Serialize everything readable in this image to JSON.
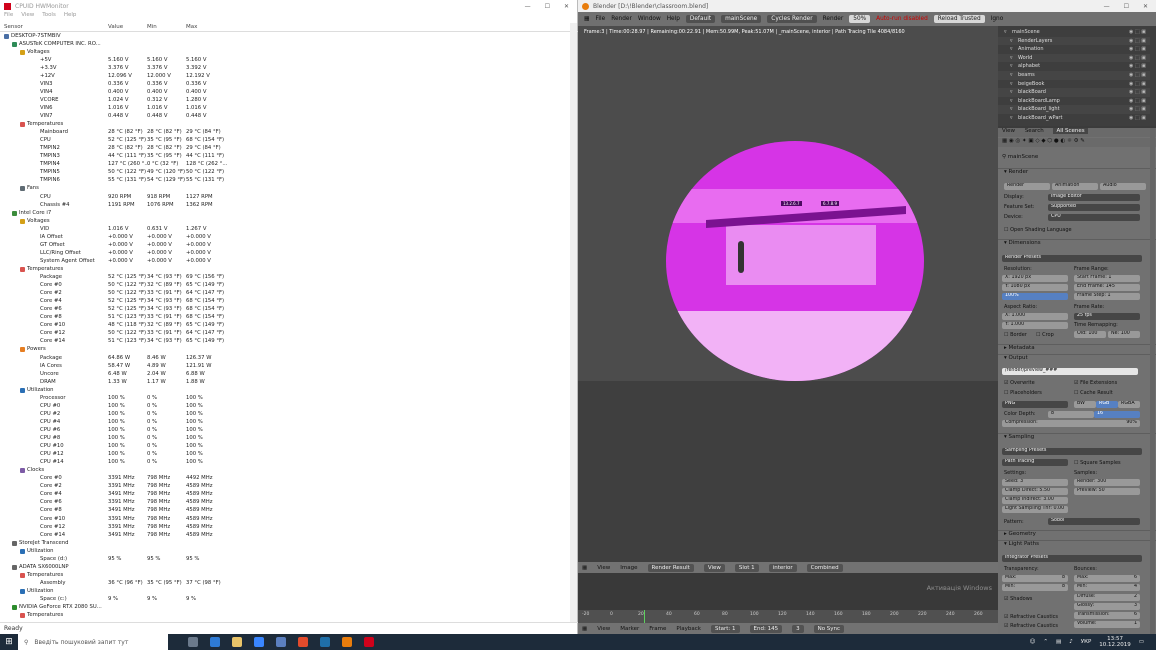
{
  "hwmonitor": {
    "title": "CPUID HWMonitor",
    "menu": [
      "File",
      "View",
      "Tools",
      "Help"
    ],
    "columns": [
      "Sensor",
      "Value",
      "Min",
      "Max"
    ],
    "status": "Ready",
    "rows": [
      {
        "indent": 0,
        "icon": "computer-icon",
        "sensor": "DESKTOP-7STMBIV",
        "value": "",
        "min": "",
        "max": ""
      },
      {
        "indent": 1,
        "icon": "motherboard-icon",
        "sensor": "ASUSTeK COMPUTER INC. RO...",
        "value": "",
        "min": "",
        "max": ""
      },
      {
        "indent": 2,
        "icon": "voltage-icon",
        "sensor": "Voltages",
        "value": "",
        "min": "",
        "max": ""
      },
      {
        "indent": 3,
        "icon": "",
        "sensor": "+5V",
        "value": "5.160 V",
        "min": "5.160 V",
        "max": "5.160 V"
      },
      {
        "indent": 3,
        "icon": "",
        "sensor": "+3.3V",
        "value": "3.376 V",
        "min": "3.376 V",
        "max": "3.392 V"
      },
      {
        "indent": 3,
        "icon": "",
        "sensor": "+12V",
        "value": "12.096 V",
        "min": "12.000 V",
        "max": "12.192 V"
      },
      {
        "indent": 3,
        "icon": "",
        "sensor": "VIN3",
        "value": "0.336 V",
        "min": "0.336 V",
        "max": "0.336 V"
      },
      {
        "indent": 3,
        "icon": "",
        "sensor": "VIN4",
        "value": "0.400 V",
        "min": "0.400 V",
        "max": "0.400 V"
      },
      {
        "indent": 3,
        "icon": "",
        "sensor": "VCORE",
        "value": "1.024 V",
        "min": "0.312 V",
        "max": "1.280 V"
      },
      {
        "indent": 3,
        "icon": "",
        "sensor": "VIN6",
        "value": "1.016 V",
        "min": "1.016 V",
        "max": "1.016 V"
      },
      {
        "indent": 3,
        "icon": "",
        "sensor": "VIN7",
        "value": "0.448 V",
        "min": "0.448 V",
        "max": "0.448 V"
      },
      {
        "indent": 2,
        "icon": "temperature-icon",
        "sensor": "Temperatures",
        "value": "",
        "min": "",
        "max": ""
      },
      {
        "indent": 3,
        "icon": "",
        "sensor": "Mainboard",
        "value": "28 °C (82 °F)",
        "min": "28 °C (82 °F)",
        "max": "29 °C (84 °F)"
      },
      {
        "indent": 3,
        "icon": "",
        "sensor": "CPU",
        "value": "52 °C (125 °F)",
        "min": "35 °C (95 °F)",
        "max": "68 °C (154 °F)"
      },
      {
        "indent": 3,
        "icon": "",
        "sensor": "TMPIN2",
        "value": "28 °C (82 °F)",
        "min": "28 °C (82 °F)",
        "max": "29 °C (84 °F)"
      },
      {
        "indent": 3,
        "icon": "",
        "sensor": "TMPIN3",
        "value": "44 °C (111 °F)",
        "min": "35 °C (95 °F)",
        "max": "44 °C (111 °F)"
      },
      {
        "indent": 3,
        "icon": "",
        "sensor": "TMPIN4",
        "value": "127 °C (260 °...",
        "min": "0 °C (32 °F)",
        "max": "128 °C (262 °..."
      },
      {
        "indent": 3,
        "icon": "",
        "sensor": "TMPIN5",
        "value": "50 °C (122 °F)",
        "min": "49 °C (120 °F)",
        "max": "50 °C (122 °F)"
      },
      {
        "indent": 3,
        "icon": "",
        "sensor": "TMPIN6",
        "value": "55 °C (131 °F)",
        "min": "54 °C (129 °F)",
        "max": "55 °C (131 °F)"
      },
      {
        "indent": 2,
        "icon": "fan-icon",
        "sensor": "Fans",
        "value": "",
        "min": "",
        "max": ""
      },
      {
        "indent": 3,
        "icon": "",
        "sensor": "CPU",
        "value": "920 RPM",
        "min": "918 RPM",
        "max": "1127 RPM"
      },
      {
        "indent": 3,
        "icon": "",
        "sensor": "Chassis #4",
        "value": "1191 RPM",
        "min": "1076 RPM",
        "max": "1362 RPM"
      },
      {
        "indent": 1,
        "icon": "cpu-icon",
        "sensor": "Intel Core i7",
        "value": "",
        "min": "",
        "max": ""
      },
      {
        "indent": 2,
        "icon": "voltage-icon",
        "sensor": "Voltages",
        "value": "",
        "min": "",
        "max": ""
      },
      {
        "indent": 3,
        "icon": "",
        "sensor": "VID",
        "value": "1.016 V",
        "min": "0.631 V",
        "max": "1.267 V"
      },
      {
        "indent": 3,
        "icon": "",
        "sensor": "IA Offset",
        "value": "+0.000 V",
        "min": "+0.000 V",
        "max": "+0.000 V"
      },
      {
        "indent": 3,
        "icon": "",
        "sensor": "GT Offset",
        "value": "+0.000 V",
        "min": "+0.000 V",
        "max": "+0.000 V"
      },
      {
        "indent": 3,
        "icon": "",
        "sensor": "LLC/Ring Offset",
        "value": "+0.000 V",
        "min": "+0.000 V",
        "max": "+0.000 V"
      },
      {
        "indent": 3,
        "icon": "",
        "sensor": "System Agent Offset",
        "value": "+0.000 V",
        "min": "+0.000 V",
        "max": "+0.000 V"
      },
      {
        "indent": 2,
        "icon": "temperature-icon",
        "sensor": "Temperatures",
        "value": "",
        "min": "",
        "max": ""
      },
      {
        "indent": 3,
        "icon": "",
        "sensor": "Package",
        "value": "52 °C (125 °F)",
        "min": "34 °C (93 °F)",
        "max": "69 °C (156 °F)"
      },
      {
        "indent": 3,
        "icon": "",
        "sensor": "Core #0",
        "value": "50 °C (122 °F)",
        "min": "32 °C (89 °F)",
        "max": "65 °C (149 °F)"
      },
      {
        "indent": 3,
        "icon": "",
        "sensor": "Core #2",
        "value": "50 °C (122 °F)",
        "min": "33 °C (91 °F)",
        "max": "64 °C (147 °F)"
      },
      {
        "indent": 3,
        "icon": "",
        "sensor": "Core #4",
        "value": "52 °C (125 °F)",
        "min": "34 °C (93 °F)",
        "max": "68 °C (154 °F)"
      },
      {
        "indent": 3,
        "icon": "",
        "sensor": "Core #6",
        "value": "52 °C (125 °F)",
        "min": "34 °C (93 °F)",
        "max": "68 °C (154 °F)"
      },
      {
        "indent": 3,
        "icon": "",
        "sensor": "Core #8",
        "value": "51 °C (123 °F)",
        "min": "33 °C (91 °F)",
        "max": "68 °C (154 °F)"
      },
      {
        "indent": 3,
        "icon": "",
        "sensor": "Core #10",
        "value": "48 °C (118 °F)",
        "min": "32 °C (89 °F)",
        "max": "65 °C (149 °F)"
      },
      {
        "indent": 3,
        "icon": "",
        "sensor": "Core #12",
        "value": "50 °C (122 °F)",
        "min": "33 °C (91 °F)",
        "max": "64 °C (147 °F)"
      },
      {
        "indent": 3,
        "icon": "",
        "sensor": "Core #14",
        "value": "51 °C (123 °F)",
        "min": "34 °C (93 °F)",
        "max": "65 °C (149 °F)"
      },
      {
        "indent": 2,
        "icon": "power-icon",
        "sensor": "Powers",
        "value": "",
        "min": "",
        "max": ""
      },
      {
        "indent": 3,
        "icon": "",
        "sensor": "Package",
        "value": "64.86 W",
        "min": "8.46 W",
        "max": "126.37 W"
      },
      {
        "indent": 3,
        "icon": "",
        "sensor": "IA Cores",
        "value": "58.47 W",
        "min": "4.89 W",
        "max": "121.91 W"
      },
      {
        "indent": 3,
        "icon": "",
        "sensor": "Uncore",
        "value": "6.48 W",
        "min": "2.04 W",
        "max": "6.88 W"
      },
      {
        "indent": 3,
        "icon": "",
        "sensor": "DRAM",
        "value": "1.33 W",
        "min": "1.17 W",
        "max": "1.88 W"
      },
      {
        "indent": 2,
        "icon": "utilization-icon",
        "sensor": "Utilization",
        "value": "",
        "min": "",
        "max": ""
      },
      {
        "indent": 3,
        "icon": "",
        "sensor": "Processor",
        "value": "100 %",
        "min": "0 %",
        "max": "100 %"
      },
      {
        "indent": 3,
        "icon": "",
        "sensor": "CPU #0",
        "value": "100 %",
        "min": "0 %",
        "max": "100 %"
      },
      {
        "indent": 3,
        "icon": "",
        "sensor": "CPU #2",
        "value": "100 %",
        "min": "0 %",
        "max": "100 %"
      },
      {
        "indent": 3,
        "icon": "",
        "sensor": "CPU #4",
        "value": "100 %",
        "min": "0 %",
        "max": "100 %"
      },
      {
        "indent": 3,
        "icon": "",
        "sensor": "CPU #6",
        "value": "100 %",
        "min": "0 %",
        "max": "100 %"
      },
      {
        "indent": 3,
        "icon": "",
        "sensor": "CPU #8",
        "value": "100 %",
        "min": "0 %",
        "max": "100 %"
      },
      {
        "indent": 3,
        "icon": "",
        "sensor": "CPU #10",
        "value": "100 %",
        "min": "0 %",
        "max": "100 %"
      },
      {
        "indent": 3,
        "icon": "",
        "sensor": "CPU #12",
        "value": "100 %",
        "min": "0 %",
        "max": "100 %"
      },
      {
        "indent": 3,
        "icon": "",
        "sensor": "CPU #14",
        "value": "100 %",
        "min": "0 %",
        "max": "100 %"
      },
      {
        "indent": 2,
        "icon": "clock-icon",
        "sensor": "Clocks",
        "value": "",
        "min": "",
        "max": ""
      },
      {
        "indent": 3,
        "icon": "",
        "sensor": "Core #0",
        "value": "3391 MHz",
        "min": "798 MHz",
        "max": "4492 MHz"
      },
      {
        "indent": 3,
        "icon": "",
        "sensor": "Core #2",
        "value": "3391 MHz",
        "min": "798 MHz",
        "max": "4589 MHz"
      },
      {
        "indent": 3,
        "icon": "",
        "sensor": "Core #4",
        "value": "3491 MHz",
        "min": "798 MHz",
        "max": "4589 MHz"
      },
      {
        "indent": 3,
        "icon": "",
        "sensor": "Core #6",
        "value": "3391 MHz",
        "min": "798 MHz",
        "max": "4589 MHz"
      },
      {
        "indent": 3,
        "icon": "",
        "sensor": "Core #8",
        "value": "3491 MHz",
        "min": "798 MHz",
        "max": "4589 MHz"
      },
      {
        "indent": 3,
        "icon": "",
        "sensor": "Core #10",
        "value": "3391 MHz",
        "min": "798 MHz",
        "max": "4589 MHz"
      },
      {
        "indent": 3,
        "icon": "",
        "sensor": "Core #12",
        "value": "3391 MHz",
        "min": "798 MHz",
        "max": "4589 MHz"
      },
      {
        "indent": 3,
        "icon": "",
        "sensor": "Core #14",
        "value": "3491 MHz",
        "min": "798 MHz",
        "max": "4589 MHz"
      },
      {
        "indent": 1,
        "icon": "drive-icon",
        "sensor": "StoreJet Transcend",
        "value": "",
        "min": "",
        "max": ""
      },
      {
        "indent": 2,
        "icon": "utilization-icon",
        "sensor": "Utilization",
        "value": "",
        "min": "",
        "max": ""
      },
      {
        "indent": 3,
        "icon": "",
        "sensor": "Space (d:)",
        "value": "95 %",
        "min": "95 %",
        "max": "95 %"
      },
      {
        "indent": 1,
        "icon": "drive-icon",
        "sensor": "ADATA SX6000LNP",
        "value": "",
        "min": "",
        "max": ""
      },
      {
        "indent": 2,
        "icon": "temperature-icon",
        "sensor": "Temperatures",
        "value": "",
        "min": "",
        "max": ""
      },
      {
        "indent": 3,
        "icon": "",
        "sensor": "Assembly",
        "value": "36 °C (96 °F)",
        "min": "35 °C (95 °F)",
        "max": "37 °C (98 °F)"
      },
      {
        "indent": 2,
        "icon": "utilization-icon",
        "sensor": "Utilization",
        "value": "",
        "min": "",
        "max": ""
      },
      {
        "indent": 3,
        "icon": "",
        "sensor": "Space (c:)",
        "value": "9 %",
        "min": "9 %",
        "max": "9 %"
      },
      {
        "indent": 1,
        "icon": "gpu-icon",
        "sensor": "NVIDIA GeForce RTX 2080 SU...",
        "value": "",
        "min": "",
        "max": ""
      },
      {
        "indent": 2,
        "icon": "temperature-icon",
        "sensor": "Temperatures",
        "value": "",
        "min": "",
        "max": ""
      }
    ]
  },
  "blender": {
    "title": "Blender [D:\\!Blender\\classroom.blend]",
    "menu": [
      "File",
      "Render",
      "Window",
      "Help"
    ],
    "layout": "Default",
    "scene": "mainScene",
    "engine": "Cycles Render",
    "render_label": "Render",
    "percent": "50%",
    "autorun": "Auto-run disabled",
    "reload": "Reload Trusted",
    "ignore": "Igno",
    "info": "Frame:3 | Time:00:28.97 | Remaining:00:22.91 | Mem:50.99M, Peak:51.07M | _mainScene, interior | Path Tracing Tile 4084/8160",
    "tags": [
      "13.2.6.7",
      "6.7.8.9"
    ],
    "watermark": "Активація Windows",
    "image_bar": {
      "items": [
        "View",
        "Image"
      ],
      "image": "Render Result",
      "view": "View",
      "slot": "Slot 1",
      "layer": "interior",
      "pass": "Combined"
    },
    "timeline": {
      "items": [
        "View",
        "Marker",
        "Frame",
        "Playback"
      ],
      "start": "Start:",
      "start_val": "1",
      "end": "End:",
      "end_val": "145",
      "frame": "3",
      "sync": "No Sync",
      "ticks": [
        "-20",
        "0",
        "20",
        "40",
        "60",
        "80",
        "100",
        "120",
        "140",
        "160",
        "180",
        "200",
        "220",
        "240",
        "260"
      ]
    },
    "outliner": [
      {
        "name": "mainScene",
        "level": 0
      },
      {
        "name": "RenderLayers",
        "level": 1
      },
      {
        "name": "Animation",
        "level": 1
      },
      {
        "name": "World",
        "level": 1
      },
      {
        "name": "alphabet",
        "level": 1
      },
      {
        "name": "beams",
        "level": 1
      },
      {
        "name": "beigeBook",
        "level": 1
      },
      {
        "name": "blackBoard",
        "level": 1
      },
      {
        "name": "blackBoardLamp",
        "level": 1
      },
      {
        "name": "blackBoard_light",
        "level": 1
      },
      {
        "name": "blackBoard_wPart",
        "level": 1
      }
    ],
    "outliner_header": {
      "view": "View",
      "search": "Search",
      "all_scenes": "All Scenes"
    },
    "props": {
      "scene": "mainScene",
      "render_section": "Render",
      "render_btn": "Render",
      "animation_btn": "Animation",
      "audio_btn": "Audio",
      "display_label": "Display:",
      "display_val": "Image Editor",
      "feature_label": "Feature Set:",
      "feature_val": "Supported",
      "device_label": "Device:",
      "device_val": "CPU",
      "osl": "Open Shading Language",
      "dimensions": "Dimensions",
      "presets": "Render Presets",
      "resolution": "Resolution:",
      "res_x": "X:",
      "res_x_val": "1920 px",
      "res_y": "Y:",
      "res_y_val": "1080 px",
      "res_pct": "100%",
      "frame_range": "Frame Range:",
      "start_frame": "Start Frame:",
      "start_frame_val": "1",
      "end_frame": "End Frame:",
      "end_frame_val": "145",
      "frame_step": "Frame Step:",
      "frame_step_val": "1",
      "aspect": "Aspect Ratio:",
      "asp_x": "X:",
      "asp_x_val": "1.000",
      "asp_y": "Y:",
      "asp_y_val": "1.000",
      "frame_rate": "Frame Rate:",
      "fps": "25 fps",
      "border": "Border",
      "crop": "Crop",
      "time_remap": "Time Remapping:",
      "old": "Old:",
      "old_val": "100",
      "new": "Ne:",
      "new_val": "100",
      "metadata": "Metadata",
      "output": "Output",
      "path": "/render/preview_###",
      "overwrite": "Overwrite",
      "file_ext": "File Extensions",
      "placeholders": "Placeholders",
      "cache": "Cache Result",
      "png": "PNG",
      "bw": "BW",
      "rgb": "RGB",
      "rgba": "RGBA",
      "depth_label": "Color Depth:",
      "depth8": "8",
      "depth16": "16",
      "compression": "Compression:",
      "compression_val": "90%",
      "sampling": "Sampling",
      "sampling_presets": "Sampling Presets",
      "path_tracing": "Path Tracing",
      "square": "Square Samples",
      "settings": "Settings:",
      "samples": "Samples:",
      "seed": "Seed:",
      "seed_val": "3",
      "clamp_direct": "Clamp Direct:",
      "clamp_direct_val": "5.50",
      "clamp_indirect": "Clamp Indirect:",
      "clamp_indirect_val": "3.00",
      "light_thr": "Light Sampling Thr:",
      "light_thr_val": "0.00",
      "render_samples": "Render:",
      "render_samples_val": "300",
      "preview_samples": "Preview:",
      "preview_samples_val": "50",
      "pattern": "Pattern:",
      "pattern_val": "Sobol",
      "geometry": "Geometry",
      "light_paths": "Light Paths",
      "integrator": "Integrator Presets",
      "transparency": "Transparency:",
      "bounces": "Bounces:",
      "max": "Max:",
      "max_val": "8",
      "min": "Min:",
      "min_val": "8",
      "b_max": "Max:",
      "b_max_val": "6",
      "b_min": "Min:",
      "b_min_val": "4",
      "shadows": "Shadows",
      "diffuse": "Diffuse:",
      "diffuse_val": "2",
      "glossy": "Glossy:",
      "glossy_val": "3",
      "transmission": "Transmission:",
      "transmission_val": "6",
      "refr_caustics": "Refractive Caustics",
      "volume": "Volume:",
      "volume_val": "1",
      "refr_caustics2": "Refractive Caustics"
    }
  },
  "taskbar": {
    "search_placeholder": "Введіть пошуковий запит тут",
    "lang": "УКР",
    "time": "13:57",
    "date": "10.12.2019"
  }
}
